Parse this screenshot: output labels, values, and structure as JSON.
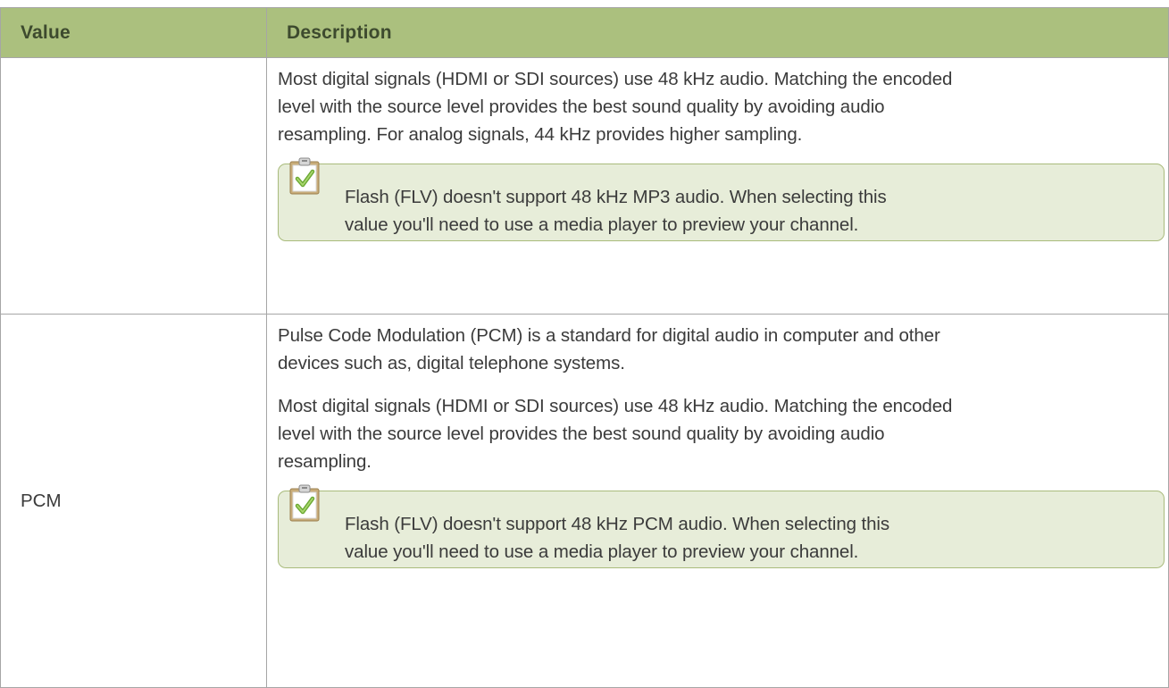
{
  "table": {
    "headers": {
      "value": "Value",
      "description": "Description"
    },
    "rows": [
      {
        "value": "",
        "paragraphs": [
          "Most digital signals (HDMI or SDI sources) use 48 kHz audio. Matching the encoded",
          "level with the source level provides the best sound quality by avoiding audio",
          "resampling. For analog signals, 44 kHz provides higher sampling."
        ],
        "note": {
          "icon": "clipboard-check-icon",
          "line1": "Flash (FLV) doesn't support 48 kHz MP3 audio. When selecting this",
          "line2": "value you'll need to use a media player to preview your channel."
        }
      },
      {
        "value": "PCM",
        "paragraph1": [
          "Pulse Code Modulation (PCM) is a standard for digital audio in computer and other",
          "devices such as, digital telephone systems."
        ],
        "paragraph2": [
          "Most digital signals (HDMI or SDI sources) use 48 kHz audio. Matching the encoded",
          "level with the source level provides the best sound quality by avoiding audio",
          "resampling."
        ],
        "note": {
          "icon": "clipboard-check-icon",
          "line1": "Flash (FLV) doesn't support 48 kHz PCM audio. When selecting this",
          "line2": "value you'll need to use a media player to preview your channel."
        }
      }
    ]
  },
  "colors": {
    "header_bg": "#abc07e",
    "note_bg": "#e7edd9",
    "note_border": "#a9bb7c"
  }
}
